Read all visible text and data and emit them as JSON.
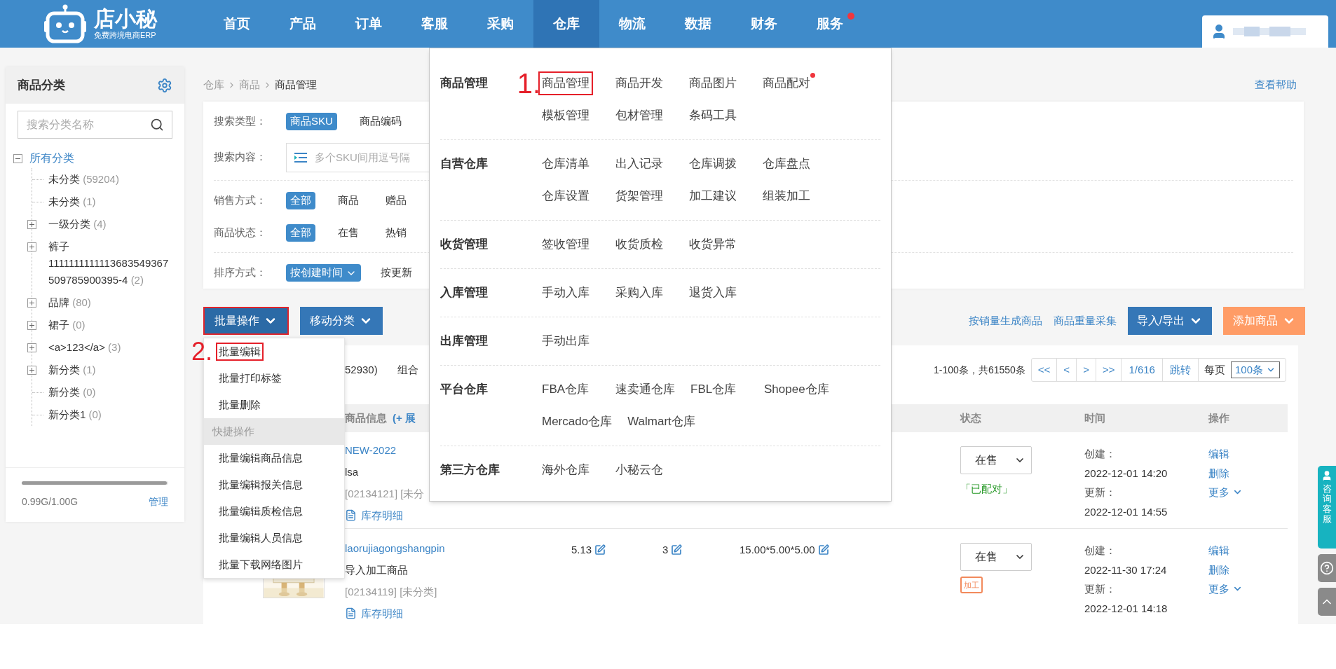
{
  "header": {
    "logo": {
      "name": "店小秘",
      "tagline": "免费跨境电商ERP"
    },
    "nav": [
      {
        "label": "首页",
        "selected": false,
        "dot": false
      },
      {
        "label": "产品",
        "selected": false,
        "dot": false
      },
      {
        "label": "订单",
        "selected": false,
        "dot": false
      },
      {
        "label": "客服",
        "selected": false,
        "dot": false
      },
      {
        "label": "采购",
        "selected": false,
        "dot": false
      },
      {
        "label": "仓库",
        "selected": true,
        "dot": false
      },
      {
        "label": "物流",
        "selected": false,
        "dot": false
      },
      {
        "label": "数据",
        "selected": false,
        "dot": false
      },
      {
        "label": "财务",
        "selected": false,
        "dot": false
      },
      {
        "label": "服务",
        "selected": false,
        "dot": true
      }
    ]
  },
  "sidebar": {
    "title": "商品分类",
    "search": {
      "placeholder": "搜索分类名称"
    },
    "tree": {
      "label": "所有分类",
      "expanded": true,
      "children": [
        {
          "label": "未分类",
          "count": "(59204)",
          "expandable": false
        },
        {
          "label": "未分类",
          "count": "(1)",
          "expandable": false
        },
        {
          "label": "一级分类",
          "count": "(4)",
          "expandable": true
        },
        {
          "label": "裤子 1111111111113683549367509785900395-4",
          "count": "(2)",
          "expandable": true
        },
        {
          "label": "品牌",
          "count": "(80)",
          "expandable": true
        },
        {
          "label": "裙子",
          "count": "(0)",
          "expandable": true
        },
        {
          "label": "<a>123</a>",
          "count": "(3)",
          "expandable": true
        },
        {
          "label": "新分类",
          "count": "(1)",
          "expandable": true
        },
        {
          "label": "新分类",
          "count": "(0)",
          "expandable": false
        },
        {
          "label": "新分类1",
          "count": "(0)",
          "expandable": false
        }
      ]
    },
    "storage": {
      "level": 0.99,
      "reading": "0.99G/1.00G",
      "link": "管理"
    }
  },
  "breadcrumb": [
    {
      "label": "仓库",
      "current": false
    },
    {
      "label": "商品",
      "current": false
    },
    {
      "label": "商品管理",
      "current": true
    }
  ],
  "help_link": "查看帮助",
  "filter_groups": [
    [
      {
        "label": "搜索类型：",
        "kind": "options",
        "options": [
          {
            "label": "商品SKU",
            "selected": true
          },
          {
            "label": "商品编码",
            "selected": false
          }
        ]
      },
      {
        "label": "搜索内容：",
        "kind": "input",
        "placeholder": "多个SKU间用逗号隔"
      }
    ],
    [
      {
        "label": "销售方式：",
        "kind": "options",
        "options": [
          {
            "label": "全部",
            "selected": true
          },
          {
            "label": "商品",
            "selected": false
          },
          {
            "label": "赠品",
            "selected": false
          }
        ]
      },
      {
        "label": "商品状态：",
        "kind": "options",
        "options": [
          {
            "label": "全部",
            "selected": true
          },
          {
            "label": "在售",
            "selected": false
          },
          {
            "label": "热销",
            "selected": false
          }
        ]
      }
    ],
    [
      {
        "label": "排序方式：",
        "kind": "sort",
        "options": [
          {
            "label": "按创建时间",
            "selected": true
          },
          {
            "label": "按更新",
            "selected": false
          }
        ]
      }
    ]
  ],
  "toolbar": {
    "left": [
      {
        "label": "批量操作",
        "annotated": true
      },
      {
        "label": "移动分类",
        "annotated": false
      }
    ],
    "links": [
      "按销量生成商品",
      "商品重量采集"
    ],
    "right": [
      {
        "label": "导入/导出",
        "kind": "primary"
      },
      {
        "label": "添加商品",
        "kind": "accent"
      }
    ]
  },
  "list": {
    "tabs": [
      "52930)",
      "组合"
    ],
    "pagination": {
      "summary": "1-100条，共61550条",
      "buttons": [
        "<<",
        "<",
        ">",
        ">>"
      ],
      "page": "1/616",
      "jump": "跳转",
      "per_page_label": "每页",
      "per_page": "100条"
    },
    "columns": {
      "info": "商品信息",
      "expand": "(+ 展",
      "status": "状态",
      "time": "时间",
      "actions": "操作"
    },
    "rows": [
      {
        "thumbnail": false,
        "sku": "NEW-2022",
        "name": "lsa",
        "code": "[02134121] [未分",
        "stock_link": "库存明细",
        "status": "在售",
        "tag": {
          "kind": "paired",
          "label": "「已配对」"
        },
        "created_label": "创建：",
        "created": "2022-12-01 14:20",
        "updated_label": "更新：",
        "updated": "2022-12-01 14:55",
        "actions": [
          "编辑",
          "删除",
          "更多"
        ]
      },
      {
        "thumbnail": true,
        "sku": "laorujiagongshangpin",
        "name": "导入加工商品",
        "code": "[02134119] [未分类]",
        "stock_link": "库存明细",
        "weight": "5.13",
        "quantity": "3",
        "size": "15.00*5.00*5.00",
        "status": "在售",
        "tag": {
          "kind": "processing",
          "label": "加工"
        },
        "created_label": "创建：",
        "created": "2022-11-30 17:24",
        "updated_label": "更新：",
        "updated": "2022-12-01 14:18",
        "actions": [
          "编辑",
          "删除",
          "更多"
        ]
      }
    ]
  },
  "mega_menu": {
    "annotation": "1.",
    "sections": [
      {
        "title": "商品管理",
        "rows": [
          [
            {
              "label": "商品管理",
              "annotated": true,
              "dot": false
            },
            {
              "label": "商品开发",
              "annotated": false,
              "dot": false
            },
            {
              "label": "商品图片",
              "annotated": false,
              "dot": false
            },
            {
              "label": "商品配对",
              "annotated": false,
              "dot": true
            }
          ],
          [
            {
              "label": "模板管理",
              "annotated": false,
              "dot": false
            },
            {
              "label": "包材管理",
              "annotated": false,
              "dot": false
            },
            {
              "label": "条码工具",
              "annotated": false,
              "dot": false
            }
          ]
        ]
      },
      {
        "title": "自营仓库",
        "rows": [
          [
            {
              "label": "仓库清单",
              "annotated": false,
              "dot": false
            },
            {
              "label": "出入记录",
              "annotated": false,
              "dot": false
            },
            {
              "label": "仓库调拨",
              "annotated": false,
              "dot": false
            },
            {
              "label": "仓库盘点",
              "annotated": false,
              "dot": false
            }
          ],
          [
            {
              "label": "仓库设置",
              "annotated": false,
              "dot": false
            },
            {
              "label": "货架管理",
              "annotated": false,
              "dot": false
            },
            {
              "label": "加工建议",
              "annotated": false,
              "dot": false
            },
            {
              "label": "组装加工",
              "annotated": false,
              "dot": false
            }
          ]
        ]
      },
      {
        "title": "收货管理",
        "rows": [
          [
            {
              "label": "签收管理",
              "annotated": false,
              "dot": false
            },
            {
              "label": "收货质检",
              "annotated": false,
              "dot": false
            },
            {
              "label": "收货异常",
              "annotated": false,
              "dot": false
            }
          ]
        ]
      },
      {
        "title": "入库管理",
        "rows": [
          [
            {
              "label": "手动入库",
              "annotated": false,
              "dot": false
            },
            {
              "label": "采购入库",
              "annotated": false,
              "dot": false
            },
            {
              "label": "退货入库",
              "annotated": false,
              "dot": false
            }
          ]
        ]
      },
      {
        "title": "出库管理",
        "rows": [
          [
            {
              "label": "手动出库",
              "annotated": false,
              "dot": false
            }
          ]
        ]
      },
      {
        "title": "平台仓库",
        "rows": [
          [
            {
              "label": "FBA仓库",
              "annotated": false,
              "dot": false
            },
            {
              "label": "速卖通仓库",
              "annotated": false,
              "dot": false
            },
            {
              "label": "FBL仓库",
              "annotated": false,
              "dot": false
            },
            {
              "label": "Shopee仓库",
              "annotated": false,
              "dot": false
            }
          ],
          [
            {
              "label": "Mercado仓库",
              "annotated": false,
              "dot": false
            },
            {
              "label": "Walmart仓库",
              "annotated": false,
              "dot": false
            }
          ]
        ]
      },
      {
        "title": "第三方仓库",
        "rows": [
          [
            {
              "label": "海外仓库",
              "annotated": false,
              "dot": false
            },
            {
              "label": "小秘云仓",
              "annotated": false,
              "dot": false
            }
          ]
        ]
      }
    ]
  },
  "batch_menu": {
    "annotation": "2.",
    "items": [
      {
        "kind": "item",
        "label": "批量编辑",
        "annotated": true
      },
      {
        "kind": "item",
        "label": "批量打印标签",
        "annotated": false
      },
      {
        "kind": "item",
        "label": "批量删除",
        "annotated": false
      },
      {
        "kind": "header",
        "label": "快捷操作",
        "annotated": false
      },
      {
        "kind": "item",
        "label": "批量编辑商品信息",
        "annotated": false
      },
      {
        "kind": "item",
        "label": "批量编辑报关信息",
        "annotated": false
      },
      {
        "kind": "item",
        "label": "批量编辑质检信息",
        "annotated": false
      },
      {
        "kind": "item",
        "label": "批量编辑人员信息",
        "annotated": false
      },
      {
        "kind": "item",
        "label": "批量下载网络图片",
        "annotated": false
      }
    ]
  },
  "side_widget": {
    "consult": "咨询客服"
  }
}
